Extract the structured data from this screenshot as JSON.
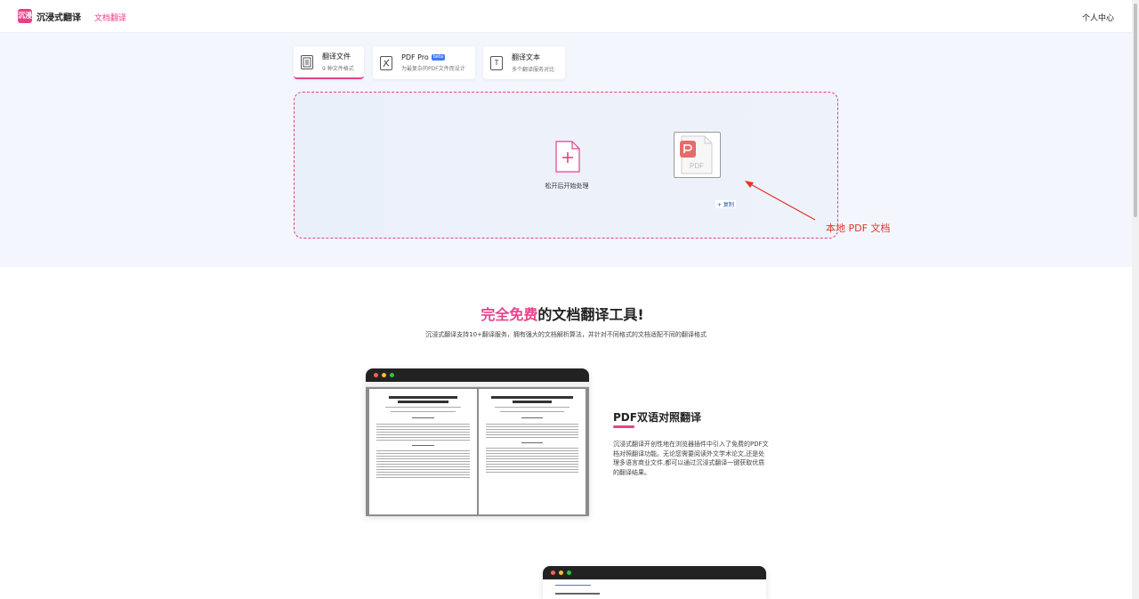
{
  "header": {
    "logo_mark": "沉浸",
    "logo_text": "沉浸式翻译",
    "nav_doc": "文档翻译",
    "user_center": "个人中心"
  },
  "tabs": [
    {
      "title": "翻译文件",
      "sub": "9 种文件格式",
      "icon": "file-stack-icon"
    },
    {
      "title": "PDF Pro",
      "badge": "beta",
      "sub": "为最复杂的PDF文件而设计",
      "icon": "pdf-icon"
    },
    {
      "title": "翻译文本",
      "sub": "多个翻译服务对比",
      "icon": "text-T-icon"
    }
  ],
  "dropzone": {
    "label": "松开后开始处理",
    "pdf_card_text": "PDF",
    "copy_badge": "+ 复制"
  },
  "annotation": {
    "text": "本地 PDF 文档",
    "color": "#e5332a"
  },
  "hero": {
    "title_accent": "完全免费",
    "title_rest": "的文档翻译工具!",
    "subtitle": "沉浸式翻译支持10+翻译服务，拥有强大的文档解析算法，并针对不同格式的文档适配不同的翻译格式"
  },
  "feature1": {
    "title": "PDF双语对照翻译",
    "description": "沉浸式翻译开创性地在浏览器插件中引入了免费的PDF文档对照翻译功能。无论您需要阅读外文学术论文,还是处理多语言商业文件,都可以通过沉浸式翻译一键获取优质的翻译结果。"
  },
  "colors": {
    "brand_pink": "#e8418a",
    "upload_bg": "#f3f6fc"
  }
}
